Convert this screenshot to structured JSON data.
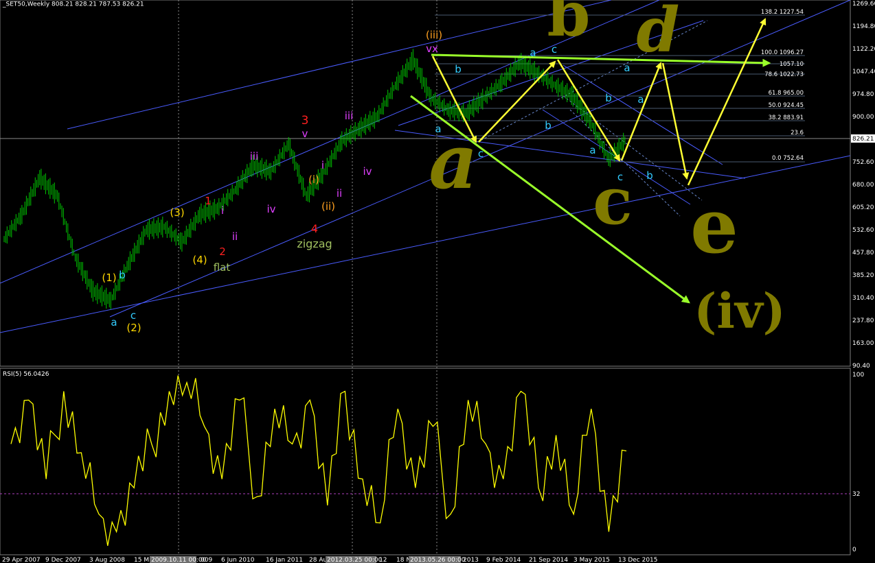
{
  "header": {
    "title": "_SET50,Weekly  808.21 828.21 787.53 826.21"
  },
  "price_scale": {
    "ticks": [
      "1269.60",
      "1194.80",
      "1122.20",
      "1047.40",
      "974.80",
      "900.00",
      "826.21",
      "752.60",
      "680.00",
      "605.20",
      "532.60",
      "457.80",
      "385.20",
      "310.40",
      "237.80",
      "163.00",
      "90.40"
    ],
    "current_price": "826.21"
  },
  "rsi_panel": {
    "label": "RSI(5) 56.0426",
    "ticks": [
      "100",
      "32",
      "0"
    ]
  },
  "time_axis": {
    "labels": [
      "29 Apr 2007",
      "9 Dec 2007",
      "3 Aug 2008",
      "15 M",
      "2009.10.11 00:00",
      "009",
      "6 Jun 2010",
      "16 Jan 2011",
      "28 Au",
      "2012.03.25 00:00",
      "12",
      "18 N",
      "2013.05.26 00:00",
      "2013",
      "9 Feb 2014",
      "21 Sep 2014",
      "3 May 2015",
      "13 Dec 2015"
    ]
  },
  "fib_levels": [
    "138.2 1227.54",
    "100.0 1096.27",
    "1057.10",
    "78.6 1022.73",
    "61.8 965.00",
    "50.0 924.45",
    "38.2 883.91",
    "23.6",
    "0.0 752.64"
  ],
  "wave_labels": {
    "l1": "(1)",
    "l2": "b",
    "l3": "a",
    "l4": "c",
    "l5": "(2)",
    "l6": "(3)",
    "l7": "(4)",
    "l8": "1",
    "l9": "i",
    "l10": "2",
    "l11": "ii",
    "l12": "flat",
    "l13": "iii",
    "l14": "iv",
    "l15": "3",
    "l16": "v",
    "l17": "i",
    "l18": "(i)",
    "l19": "ii",
    "l20": "(ii)",
    "l21": "4",
    "l22": "zigzag",
    "l23": "iii",
    "l24": "iv",
    "l25": "(iii)",
    "l26": "vx",
    "l27": "b",
    "l28": "a",
    "l29": "c",
    "l30": "a",
    "l31": "c",
    "l32": "b",
    "l33": "a",
    "l34": "b",
    "l35": "a",
    "l36": "c",
    "l37": "b",
    "l38": "a",
    "l39": "c"
  },
  "big_annotations": {
    "a": "a",
    "b": "b",
    "c": "c",
    "d": "d",
    "e": "e",
    "iv": "(iv)"
  },
  "colors": {
    "background": "#000000",
    "price_bars": "#00c800",
    "rsi_line": "#ffff00",
    "trendlines": "#4a5cff",
    "forecast_arrows": "#ffff33",
    "green_arrows": "#9aff2a",
    "big_labels": "#807a00",
    "cyan_labels": "#33ccff",
    "magenta_labels": "#e040ff",
    "red_labels": "#ff2020",
    "yellow_labels": "#ffd700",
    "orange_labels": "#ffa020"
  },
  "chart_data": [
    {
      "type": "line",
      "title": "_SET50,Weekly",
      "ohlc_last": {
        "open": 808.21,
        "high": 828.21,
        "low": 787.53,
        "close": 826.21
      },
      "x": [
        "2007-04",
        "2007-09",
        "2007-12",
        "2008-03",
        "2008-06",
        "2008-10",
        "2008-12",
        "2009-04",
        "2009-07",
        "2009-09",
        "2009-12",
        "2010-04",
        "2010-07",
        "2010-10",
        "2011-01",
        "2011-05",
        "2011-08",
        "2011-10",
        "2012-01",
        "2012-04",
        "2012-07",
        "2012-10",
        "2013-01",
        "2013-04",
        "2013-06",
        "2013-09",
        "2013-12",
        "2014-03",
        "2014-06",
        "2014-09",
        "2014-12",
        "2015-03",
        "2015-06",
        "2015-09",
        "2015-12",
        "2016-01"
      ],
      "series": [
        {
          "values": [
            500,
            580,
            700,
            640,
            440,
            330,
            300,
            420,
            530,
            540,
            490,
            580,
            600,
            660,
            740,
            720,
            810,
            640,
            720,
            820,
            860,
            900,
            1000,
            1085,
            960,
            920,
            910,
            960,
            1010,
            1075,
            1040,
            1000,
            965,
            880,
            760,
            826
          ]
        }
      ],
      "ylim": [
        90.4,
        1269.6
      ],
      "grid": false
    },
    {
      "type": "line",
      "title": "RSI(5) 56.0426",
      "series": [
        {
          "values": [
            60,
            85,
            40,
            90,
            55,
            20,
            10,
            35,
            60,
            90,
            95,
            70,
            40,
            85,
            30,
            80,
            60,
            85,
            25,
            90,
            40,
            15,
            80,
            35,
            70,
            20,
            85,
            60,
            40,
            90,
            35,
            65,
            20,
            80,
            10,
            56
          ]
        }
      ],
      "ylim": [
        0,
        100
      ],
      "reference_line": 32
    }
  ]
}
